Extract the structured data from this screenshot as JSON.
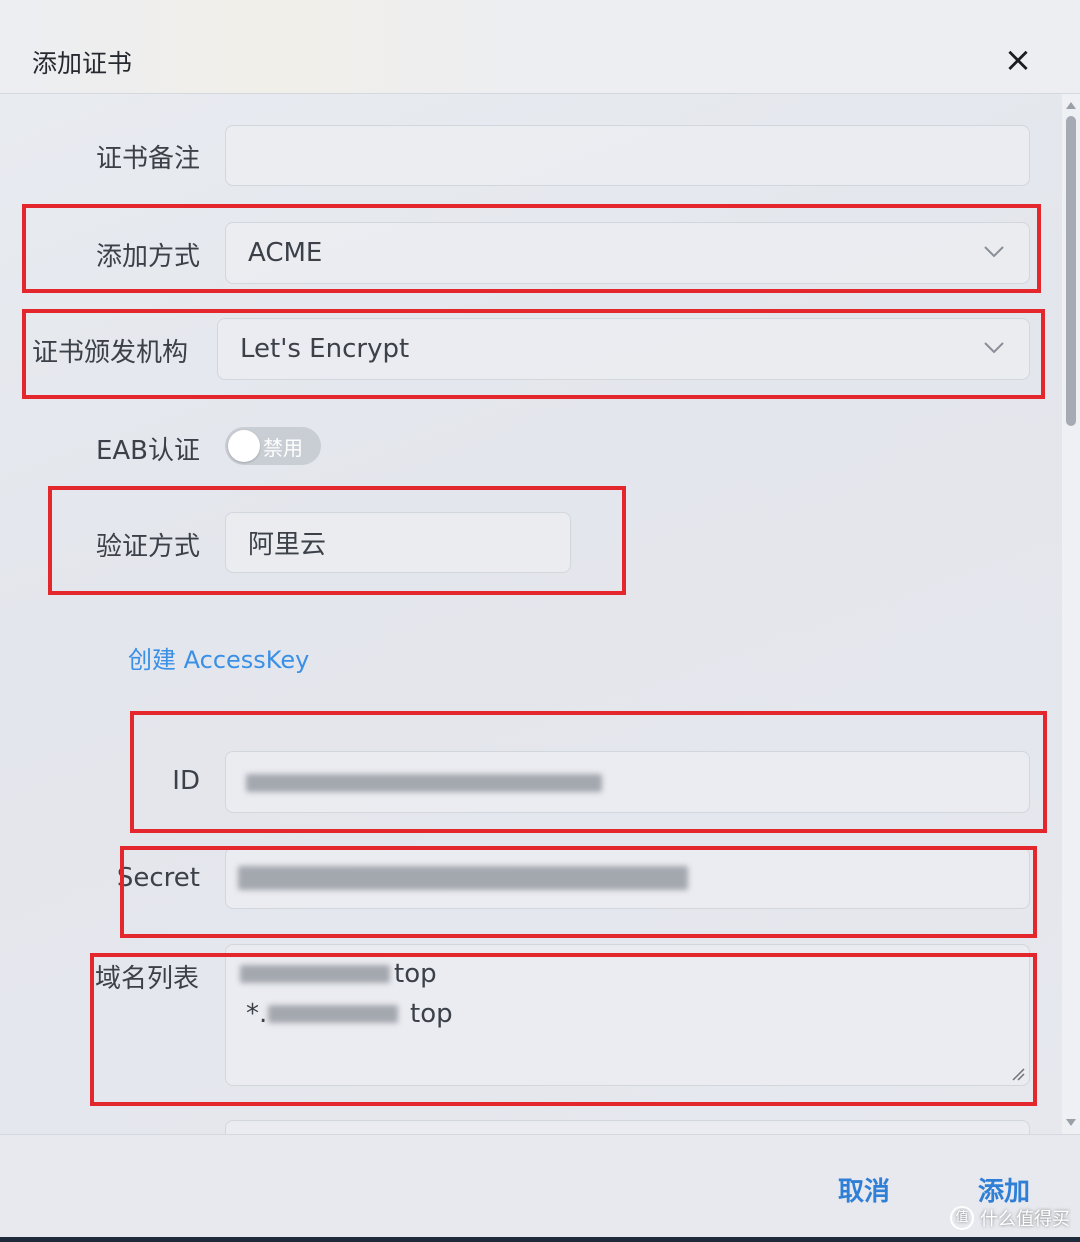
{
  "dialog": {
    "title": "添加证书",
    "close_icon": "×"
  },
  "form": {
    "remark": {
      "label": "证书备注",
      "value": ""
    },
    "add_method": {
      "label": "添加方式",
      "value": "ACME"
    },
    "ca": {
      "label": "证书颁发机构",
      "value": "Let's Encrypt"
    },
    "eab": {
      "label": "EAB认证",
      "toggle_text": "禁用",
      "enabled": false
    },
    "verify_method": {
      "label": "验证方式",
      "value": "阿里云"
    },
    "create_accesskey_link": "创建 AccessKey",
    "id": {
      "label": "ID"
    },
    "secret": {
      "label": "Secret"
    },
    "domains": {
      "label": "域名列表",
      "line1_visible": "top",
      "line2_prefix": "*.",
      "line2_visible": "top"
    }
  },
  "footer": {
    "cancel_label": "取消",
    "add_label": "添加"
  },
  "watermark": {
    "text": "什么值得买",
    "logo": "值"
  },
  "colors": {
    "accent": "#2f7fd6",
    "link": "#3a8fe6",
    "highlight_box": "#e4272d"
  },
  "icons": {
    "close": "close-icon",
    "dropdown": "chevron-down-icon",
    "resize": "resize-handle-icon"
  }
}
